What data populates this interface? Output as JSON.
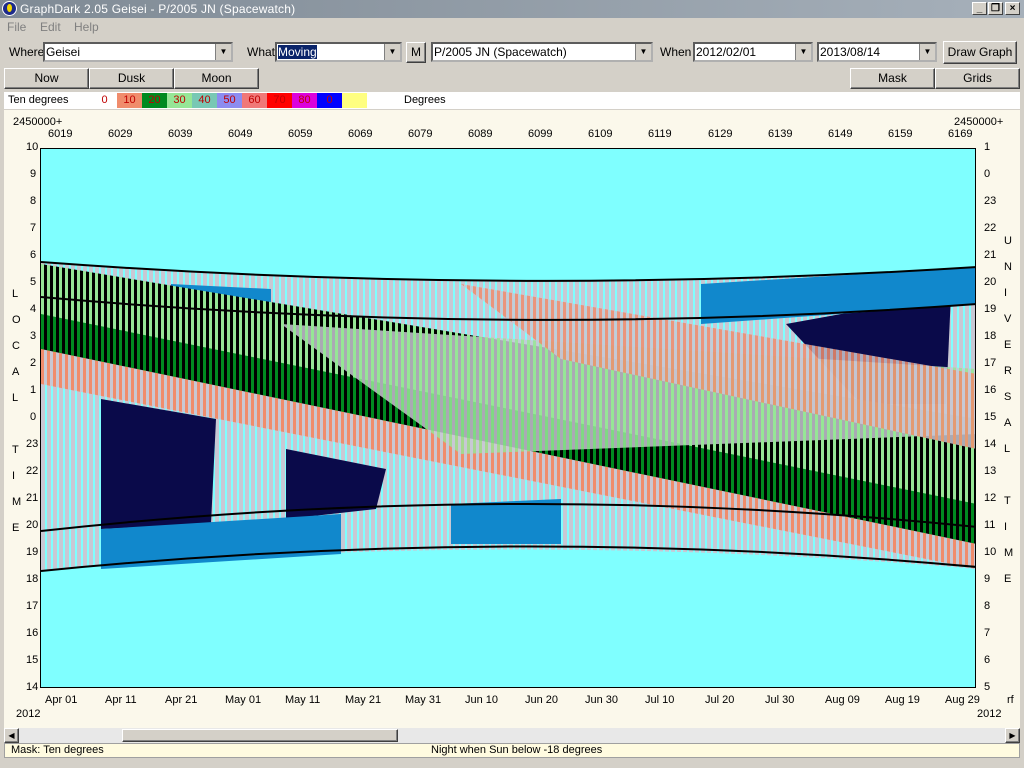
{
  "window": {
    "title": "GraphDark 2.05  Geisei  -  P/2005 JN (Spacewatch)"
  },
  "menu": [
    "File",
    "Edit",
    "Help"
  ],
  "toolbar": {
    "where_label": "Where",
    "where_value": "Geisei",
    "what_label": "What",
    "what_value": "Moving",
    "m_button": "M",
    "object_value": "P/2005 JN (Spacewatch)",
    "when_label": "When",
    "date_from": "2012/02/01",
    "date_to": "2013/08/14",
    "draw_button": "Draw Graph"
  },
  "buttons": {
    "now": "Now",
    "dusk": "Dusk",
    "moon": "Moon",
    "mask": "Mask",
    "grids": "Grids"
  },
  "legend": {
    "label": "Ten degrees",
    "unit": "Degrees",
    "swatches": [
      {
        "text": "0",
        "color": "#ffffff"
      },
      {
        "text": "10",
        "color": "#f08c6c"
      },
      {
        "text": "20",
        "color": "#008a20"
      },
      {
        "text": "30",
        "color": "#96e696"
      },
      {
        "text": "40",
        "color": "#78c8b4"
      },
      {
        "text": "50",
        "color": "#8c8cf0"
      },
      {
        "text": "60",
        "color": "#f07878"
      },
      {
        "text": "70",
        "color": "#ff0000"
      },
      {
        "text": "80",
        "color": "#dc00dc"
      },
      {
        "text": "0",
        "color": "#0000ff"
      },
      {
        "text": "",
        "color": "#ffff80"
      }
    ]
  },
  "axes": {
    "jd_prefix_left": "2450000+",
    "jd_prefix_right": "2450000+",
    "jd_ticks": [
      "6019",
      "6029",
      "6039",
      "6049",
      "6059",
      "6069",
      "6079",
      "6089",
      "6099",
      "6109",
      "6119",
      "6129",
      "6139",
      "6149",
      "6159",
      "6169"
    ],
    "local_ticks": [
      "10",
      "9",
      "8",
      "7",
      "6",
      "5",
      "4",
      "3",
      "2",
      "1",
      "0",
      "23",
      "22",
      "21",
      "20",
      "19",
      "18",
      "17",
      "16",
      "15",
      "14"
    ],
    "ut_ticks": [
      "1",
      "0",
      "23",
      "22",
      "21",
      "20",
      "19",
      "18",
      "17",
      "16",
      "15",
      "14",
      "13",
      "12",
      "11",
      "10",
      "9",
      "8",
      "7",
      "6",
      "5"
    ],
    "date_ticks": [
      "Apr 01",
      "Apr 11",
      "Apr 21",
      "May 01",
      "May 11",
      "May 21",
      "May 31",
      "Jun 10",
      "Jun 20",
      "Jun 30",
      "Jul 10",
      "Jul 20",
      "Jul 30",
      "Aug 09",
      "Aug 19",
      "Aug 29"
    ],
    "year_left": "2012",
    "year_right": "2012",
    "rf": "rf",
    "local_title": [
      "L",
      "O",
      "C",
      "A",
      "L",
      "",
      "T",
      "I",
      "M",
      "E"
    ],
    "ut_title": [
      "U",
      "N",
      "I",
      "V",
      "E",
      "R",
      "S",
      "A",
      "L",
      "",
      "T",
      "I",
      "M",
      "E"
    ]
  },
  "status": {
    "mask": "Mask:  Ten degrees",
    "night": "Night when Sun below -18 degrees"
  },
  "colors": {
    "sky": "#7fffff",
    "dark": "#0a0a4a",
    "blue": "#1188cc",
    "grey": "#c8c8d4"
  }
}
